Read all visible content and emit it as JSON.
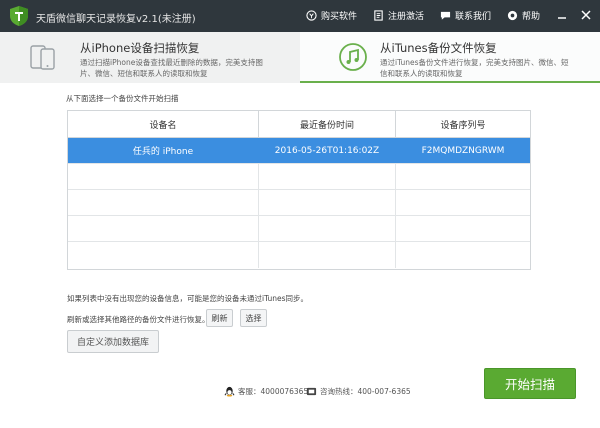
{
  "app": {
    "title": "天盾微信聊天记录恢复v2.1(未注册)"
  },
  "top_links": [
    {
      "label": "购买软件",
      "icon": "cart-icon"
    },
    {
      "label": "注册激活",
      "icon": "register-icon"
    },
    {
      "label": "联系我们",
      "icon": "chat-icon"
    },
    {
      "label": "帮助",
      "icon": "settings-icon"
    }
  ],
  "modes": [
    {
      "title": "从iPhone设备扫描恢复",
      "desc": "通过扫描iPhone设备查找最近删除的数据，完美支持图片、微信、短信和联系人的读取和恢复",
      "icon": "phone-icon"
    },
    {
      "title": "从iTunes备份文件恢复",
      "desc": "通过iTunes备份文件进行恢复，完美支持图片、微信、短信和联系人的读取和恢复",
      "icon": "music-note-icon",
      "selected": true
    }
  ],
  "prompt": "从下面选择一个备份文件开始扫描",
  "table": {
    "headers": [
      "设备名",
      "最近备份时间",
      "设备序列号"
    ],
    "rows": [
      [
        "任兵的 iPhone",
        "2016-05-26T01:16:02Z",
        "F2MQMDZNGRWM"
      ],
      [
        "",
        "",
        ""
      ],
      [
        "",
        "",
        ""
      ],
      [
        "",
        "",
        ""
      ],
      [
        "",
        "",
        ""
      ]
    ]
  },
  "notes": {
    "line1": "如果列表中没有出现您的设备信息，可能是您的设备未通过iTunes同步。",
    "line2": "刷新或选择其他路径的备份文件进行恢复。"
  },
  "buttons": {
    "refresh": "刷新",
    "select": "选择",
    "add_db": "自定义添加数据库",
    "start": "开始扫描"
  },
  "footer": {
    "qq": "客服：4000076365",
    "phone": "咨询热线：400-007-6365"
  },
  "colors": {
    "titlebar": "#2f373d",
    "accent": "#5aaa32",
    "selected_row": "#3b8ee0"
  }
}
